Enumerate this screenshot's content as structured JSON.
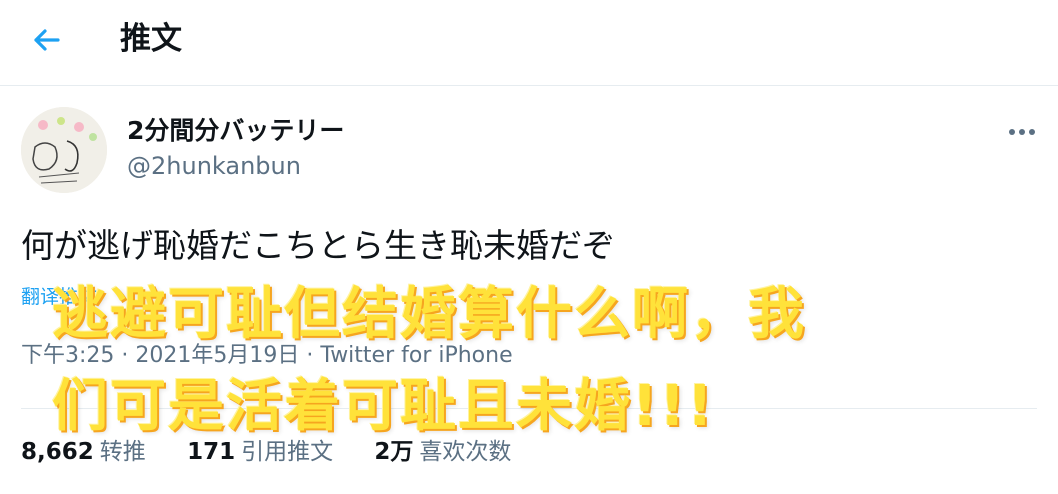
{
  "header": {
    "title": "推文",
    "back_icon": "arrow-left-icon"
  },
  "author": {
    "display_name": "2分間分バッテリー",
    "handle": "@2hunkanbun",
    "avatar_lettering": "2hunkanbun"
  },
  "tweet": {
    "text": "何が逃げ恥婚だこちとら生き恥未婚だぞ",
    "translate_label": "翻译推文",
    "time": "下午3:25",
    "separator": "·",
    "date": "2021年5月19日",
    "source": "Twitter for iPhone"
  },
  "stats": {
    "retweets_count": "8,662",
    "retweets_label": "转推",
    "quotes_count": "171",
    "quotes_label": "引用推文",
    "likes_count": "2万",
    "likes_label": "喜欢次数"
  },
  "overlay": {
    "line1": "逃避可耻但结婚算什么啊，我",
    "line2": "们可是活着可耻且未婚!!!"
  },
  "colors": {
    "accent": "#1da1f2",
    "secondary_text": "#5b7083",
    "overlay_fill": "#ffe23a"
  }
}
